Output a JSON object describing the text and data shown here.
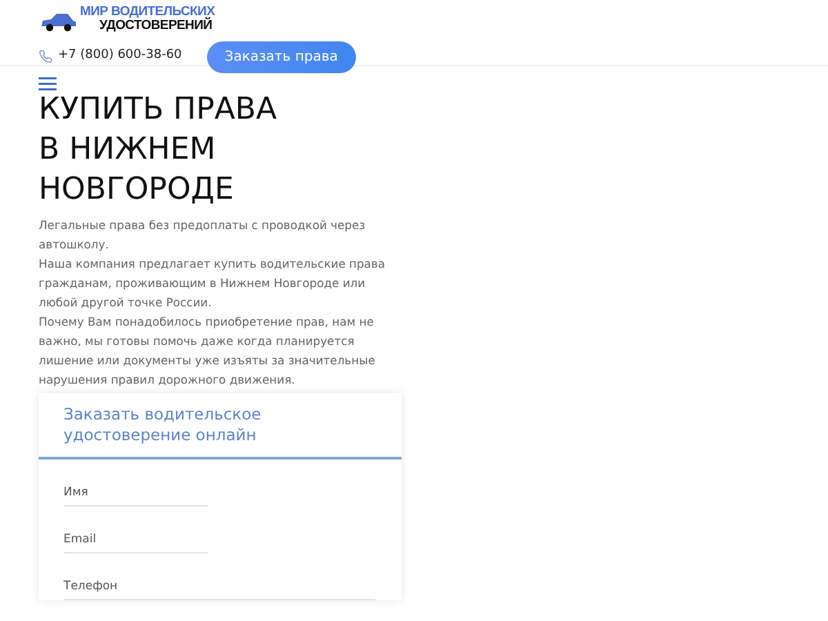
{
  "logo": {
    "line_1": "МИР ВОДИТЕЛЬСКИХ",
    "line_2": "УДОСТОВЕРЕНИЙ"
  },
  "phone": "+7 (800) 600-38-60",
  "order_button": "Заказать права",
  "title": "КУПИТЬ ПРАВА В НИЖНЕМ НОВГОРОДЕ",
  "paragraphs": [
    "Легальные права без предоплаты с проводкой через автошколу.",
    "Наша компания предлагает купить водительские права гражданам, проживающим в Нижнем Новгороде или любой другой точке России.",
    "Почему Вам понадобилось приобретение прав, нам не важно, мы готовы помочь даже когда планируется лишение или документы уже изъяты за значительные нарушения правил дорожного движения."
  ],
  "form": {
    "title": "Заказать водительское удостоверение онлайн",
    "fields": [
      {
        "placeholder": "Имя",
        "wide": false
      },
      {
        "placeholder": "Email",
        "wide": false
      },
      {
        "placeholder": "Телефон",
        "wide": true
      }
    ]
  }
}
